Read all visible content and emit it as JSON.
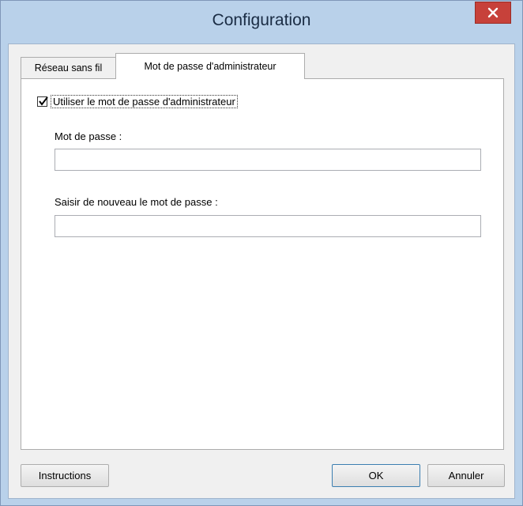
{
  "window": {
    "title": "Configuration"
  },
  "tabs": [
    {
      "label": "Réseau sans fil",
      "active": false
    },
    {
      "label": "Mot de passe d'administrateur",
      "active": true
    }
  ],
  "form": {
    "use_admin_password": {
      "label": "Utiliser le mot de passe d'administrateur",
      "checked": true
    },
    "password_label": "Mot de passe :",
    "password_value": "",
    "confirm_label": "Saisir de nouveau le mot de passe :",
    "confirm_value": ""
  },
  "buttons": {
    "instructions": "Instructions",
    "ok": "OK",
    "cancel": "Annuler"
  },
  "colors": {
    "close_button": "#c7413a",
    "frame": "#b9d1ea"
  }
}
